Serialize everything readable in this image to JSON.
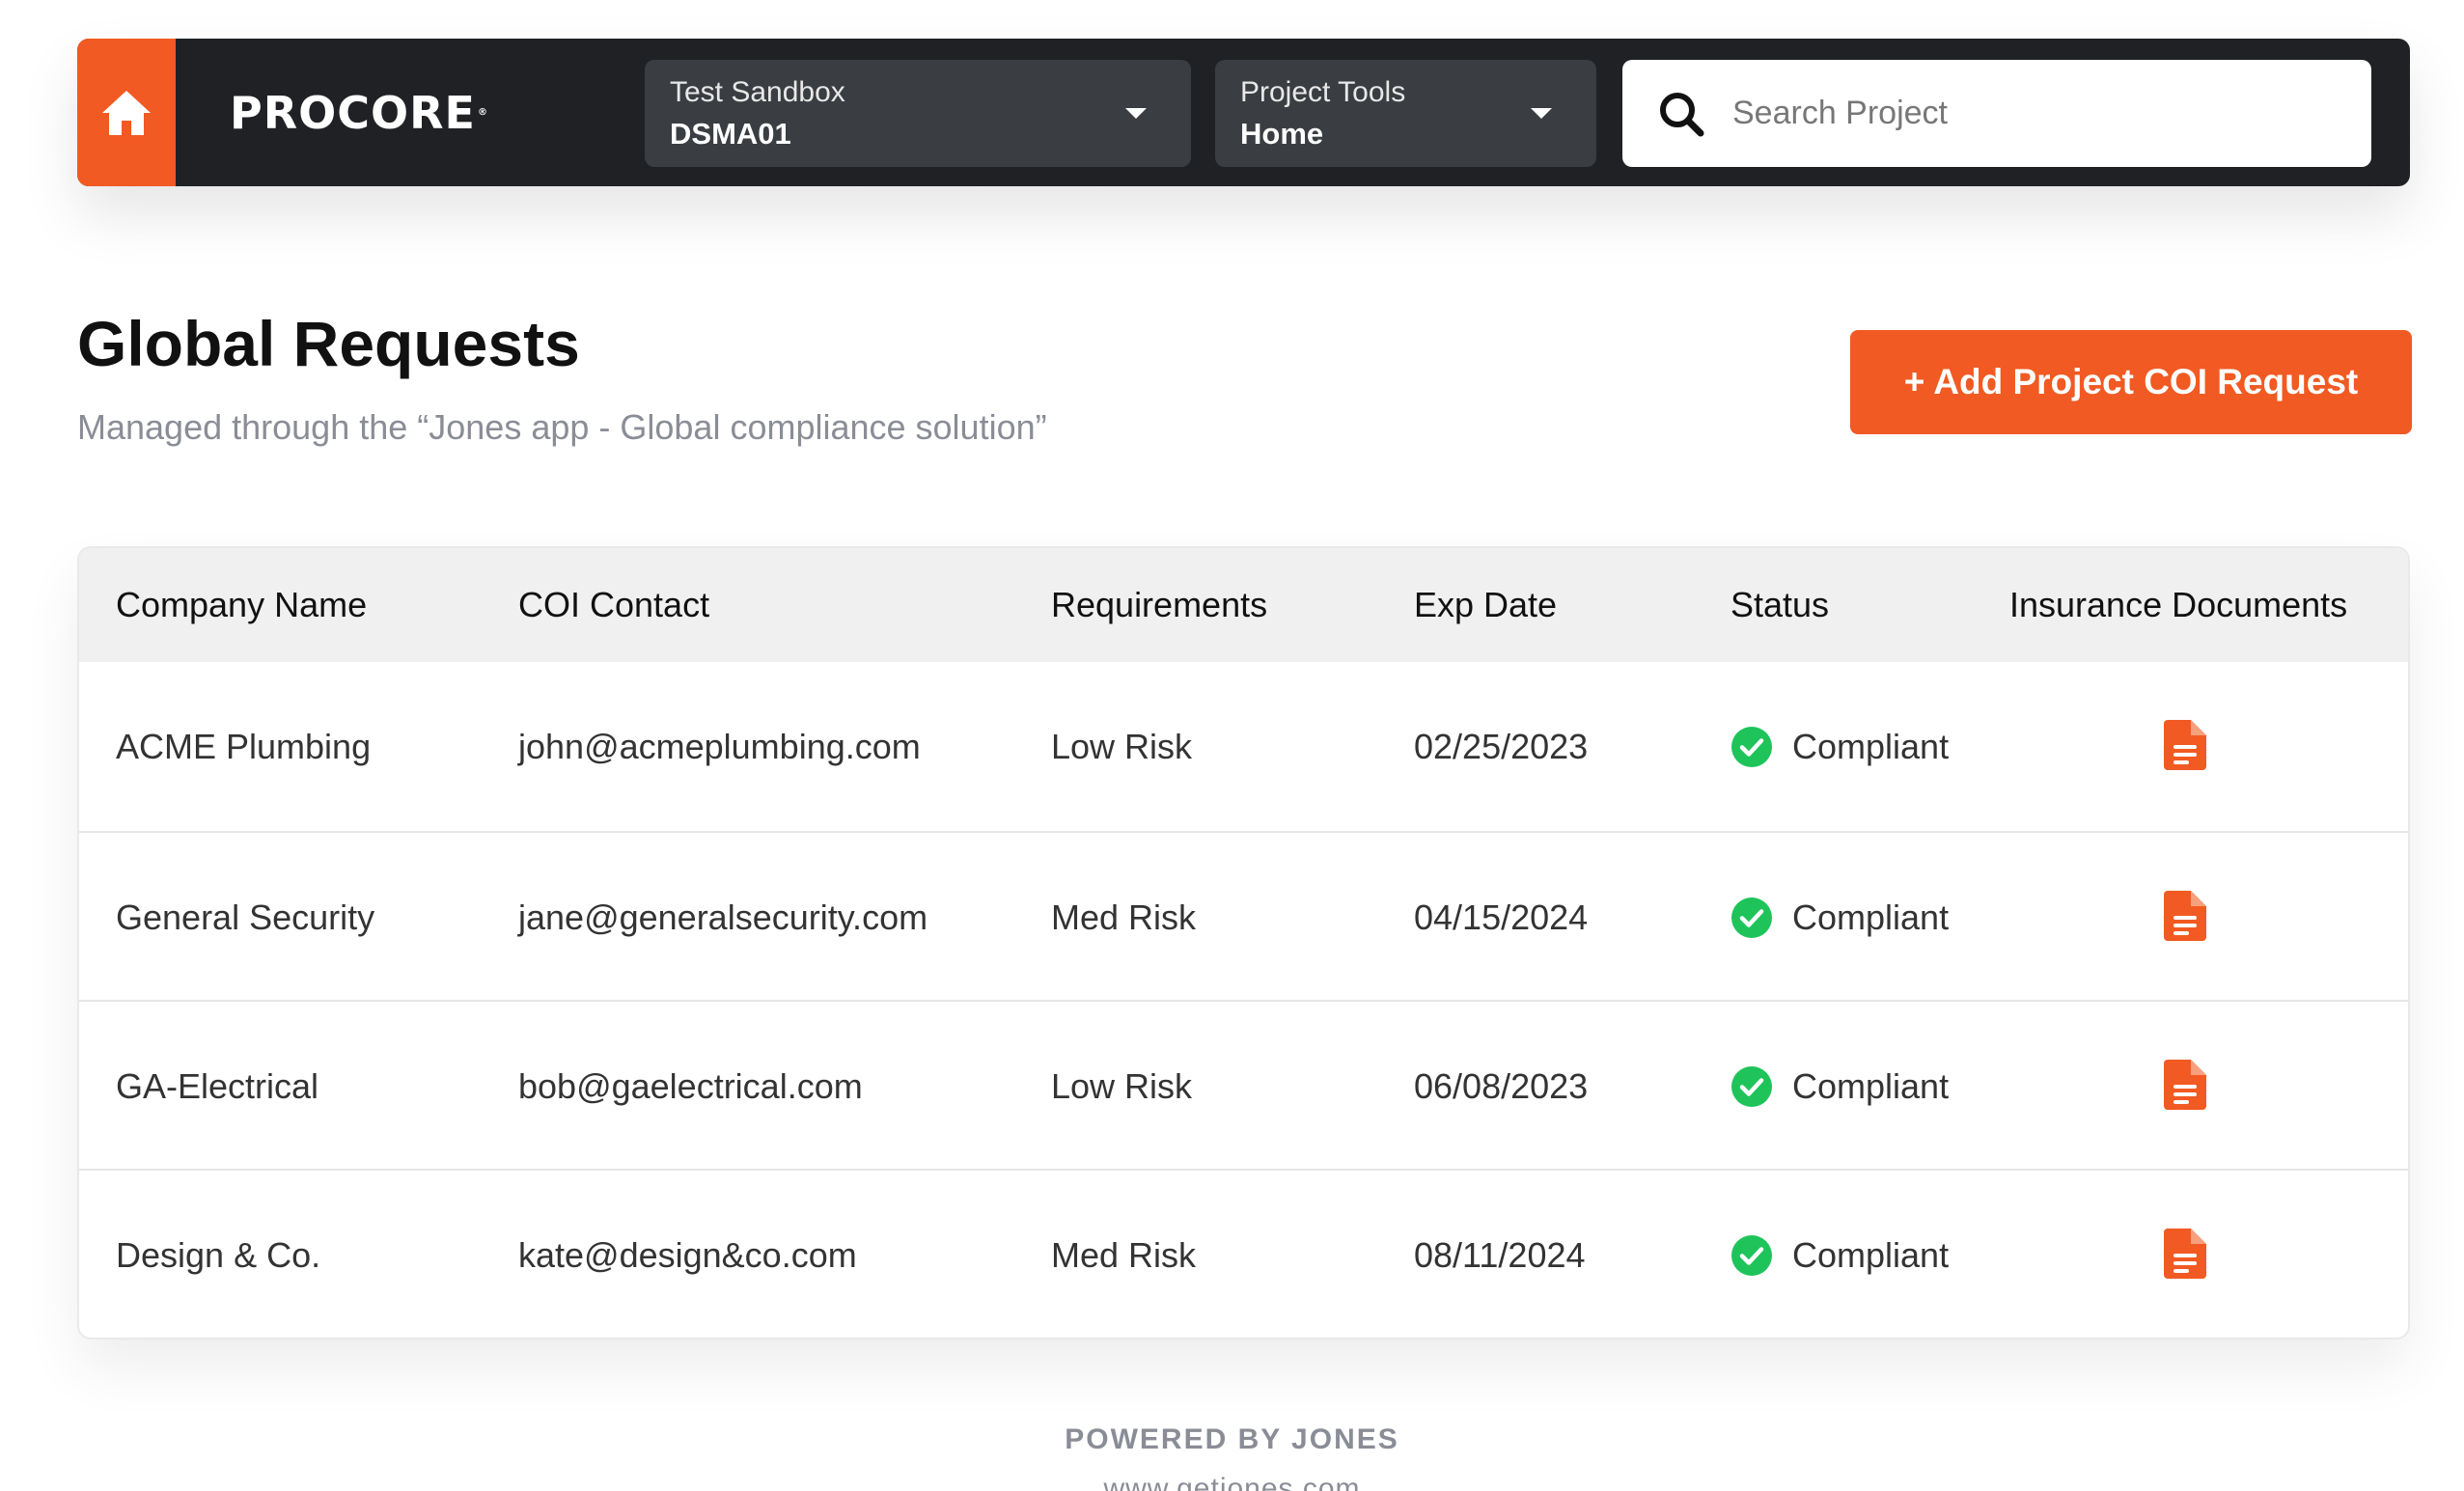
{
  "header": {
    "logo_text": "PROCORE",
    "project_selector": {
      "label": "Test Sandbox",
      "value": "DSMA01"
    },
    "tools_selector": {
      "label": "Project Tools",
      "value": "Home"
    },
    "search": {
      "placeholder": "Search Project",
      "value": ""
    }
  },
  "page": {
    "title": "Global Requests",
    "subtitle": "Managed through the “Jones app - Global compliance solution”",
    "add_button_label": "+ Add Project COI Request"
  },
  "table": {
    "columns": [
      "Company Name",
      "COI Contact",
      "Requirements",
      "Exp Date",
      "Status",
      "Insurance Documents"
    ],
    "rows": [
      {
        "company": "ACME Plumbing",
        "contact": "john@acmeplumbing.com",
        "requirements": "Low Risk",
        "exp_date": "02/25/2023",
        "status": "Compliant"
      },
      {
        "company": "General Security",
        "contact": "jane@generalsecurity.com",
        "requirements": "Med Risk",
        "exp_date": "04/15/2024",
        "status": "Compliant"
      },
      {
        "company": "GA-Electrical",
        "contact": "bob@gaelectrical.com",
        "requirements": "Low Risk",
        "exp_date": "06/08/2023",
        "status": "Compliant"
      },
      {
        "company": "Design & Co.",
        "contact": "kate@design&co.com",
        "requirements": "Med Risk",
        "exp_date": "08/11/2024",
        "status": "Compliant"
      }
    ]
  },
  "footer": {
    "powered_by": "POWERED BY JONES",
    "url": "www.getjones.com"
  },
  "icons": {
    "home": "home-icon",
    "search": "search-icon",
    "caret": "chevron-down-icon",
    "status": "check-circle-icon",
    "document": "document-icon"
  },
  "colors": {
    "brand_orange": "#f15a22",
    "header_dark": "#1f2124",
    "compliant_green": "#1ec45a",
    "muted_text": "#8a8d96"
  }
}
